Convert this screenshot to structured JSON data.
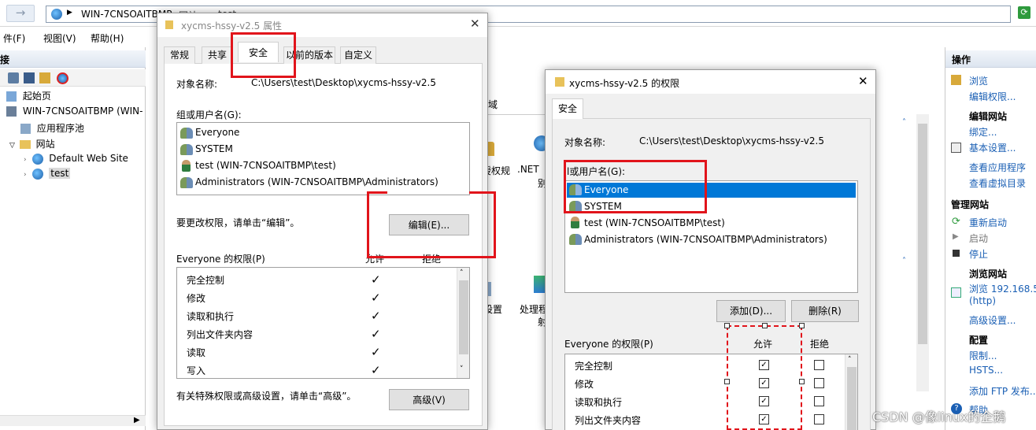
{
  "iis": {
    "address": {
      "parts": [
        "WIN-7CNSOAITBMP",
        "网站",
        "test"
      ]
    },
    "menu": [
      "文件(F)",
      "视图(V)",
      "帮助(H)"
    ],
    "menu_visible": [
      "件(F)",
      "视图(V)",
      "帮助(H)"
    ],
    "left_header": "接",
    "tree": [
      {
        "label": "起始页"
      },
      {
        "label": "WIN-7CNSOAITBMP (WIN-"
      },
      {
        "label": "应用程序池"
      },
      {
        "label": "网站"
      },
      {
        "label": "Default Web Site"
      },
      {
        "label": "test"
      }
    ],
    "center": {
      "frag1": "域",
      "frag2": "授权规",
      "frag3": ".NET",
      "frag4": "别",
      "frag5": "设置",
      "frag6": "处理程",
      "frag7": "射"
    },
    "right": {
      "header": "操作",
      "browse": "浏览",
      "edit_perm": "编辑权限...",
      "edit_site": "编辑网站",
      "bind": "绑定...",
      "basic": "基本设置...",
      "view_apps": "查看应用程序",
      "view_vdirs": "查看虚拟目录",
      "manage_site": "管理网站",
      "restart": "重新启动",
      "start": "启动",
      "stop": "停止",
      "browse_site": "浏览网站",
      "browse_url": "浏览 192.168.5",
      "http": "(http)",
      "advanced": "高级设置...",
      "config": "配置",
      "limits": "限制...",
      "hsts": "HSTS...",
      "ftp": "添加 FTP 发布...",
      "help": "帮助"
    }
  },
  "dialog1": {
    "title": "xycms-hssy-v2.5 属性",
    "tabs": [
      "常规",
      "共享",
      "安全",
      "以前的版本",
      "自定义"
    ],
    "object_label": "对象名称:",
    "object_value": "C:\\Users\\test\\Desktop\\xycms-hssy-v2.5",
    "group_label": "组或用户名(G):",
    "users": [
      "Everyone",
      "SYSTEM",
      "test (WIN-7CNSOAITBMP\\test)",
      "Administrators (WIN-7CNSOAITBMP\\Administrators)"
    ],
    "change_hint": "要更改权限，请单击“编辑”。",
    "edit_button": "编辑(E)...",
    "perm_label": "Everyone 的权限(P)",
    "allow": "允许",
    "deny": "拒绝",
    "perms": [
      "完全控制",
      "修改",
      "读取和执行",
      "列出文件夹内容",
      "读取",
      "写入"
    ],
    "allowed": [
      true,
      true,
      true,
      true,
      true,
      true
    ],
    "advanced_hint": "有关特殊权限或高级设置，请单击“高级”。",
    "advanced_button": "高级(V)"
  },
  "dialog2": {
    "title": "xycms-hssy-v2.5 的权限",
    "tab": "安全",
    "object_label": "对象名称:",
    "object_value": "C:\\Users\\test\\Desktop\\xycms-hssy-v2.5",
    "group_label": "组或用户名(G):",
    "group_label_visible": "l或用户名(G):",
    "users": [
      "Everyone",
      "SYSTEM",
      "test (WIN-7CNSOAITBMP\\test)",
      "Administrators (WIN-7CNSOAITBMP\\Administrators)"
    ],
    "selected_user": "Everyone",
    "add_button": "添加(D)...",
    "remove_button": "删除(R)",
    "perm_label": "Everyone 的权限(P)",
    "allow": "允许",
    "deny": "拒绝",
    "perms": [
      "完全控制",
      "修改",
      "读取和执行",
      "列出文件夹内容"
    ],
    "allow_checked": [
      true,
      true,
      true,
      true
    ],
    "deny_checked": [
      false,
      false,
      false,
      false
    ]
  },
  "watermark": "CSDN @像linux的企鹅",
  "colors": {
    "highlight": "#e1141b",
    "selection": "#0078d7",
    "link": "#1a5fb4"
  }
}
